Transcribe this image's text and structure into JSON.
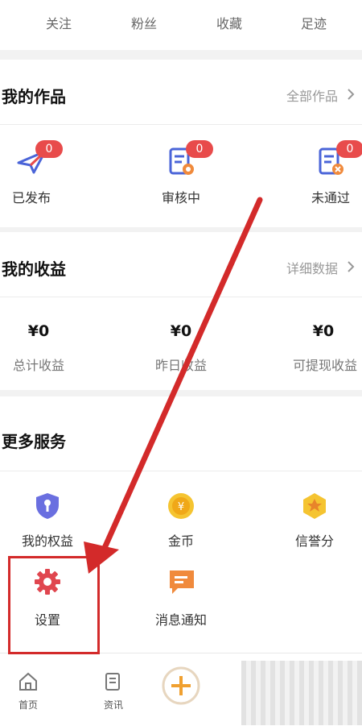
{
  "top_stats": {
    "follow": "关注",
    "fans": "粉丝",
    "favorites": "收藏",
    "footprint": "足迹"
  },
  "works": {
    "title": "我的作品",
    "link": "全部作品",
    "items": [
      {
        "label": "已发布",
        "count": "0"
      },
      {
        "label": "审核中",
        "count": "0"
      },
      {
        "label": "未通过",
        "count": "0"
      }
    ]
  },
  "earnings": {
    "title": "我的收益",
    "link": "详细数据",
    "items": [
      {
        "value": "¥0",
        "label": "总计收益"
      },
      {
        "value": "¥0",
        "label": "昨日收益"
      },
      {
        "value": "¥0",
        "label": "可提现收益"
      }
    ]
  },
  "services": {
    "title": "更多服务",
    "items": [
      {
        "label": "我的权益",
        "icon": "shield-key-icon"
      },
      {
        "label": "金币",
        "icon": "coin-icon"
      },
      {
        "label": "信誉分",
        "icon": "credit-badge-icon"
      },
      {
        "label": "设置",
        "icon": "gear-icon"
      },
      {
        "label": "消息通知",
        "icon": "message-icon"
      }
    ]
  },
  "bottom_nav": {
    "home": "首页",
    "news": "资讯"
  },
  "colors": {
    "badge": "#e84b4b",
    "arrow": "#d32a2a",
    "accent_orange": "#f08a3c"
  }
}
